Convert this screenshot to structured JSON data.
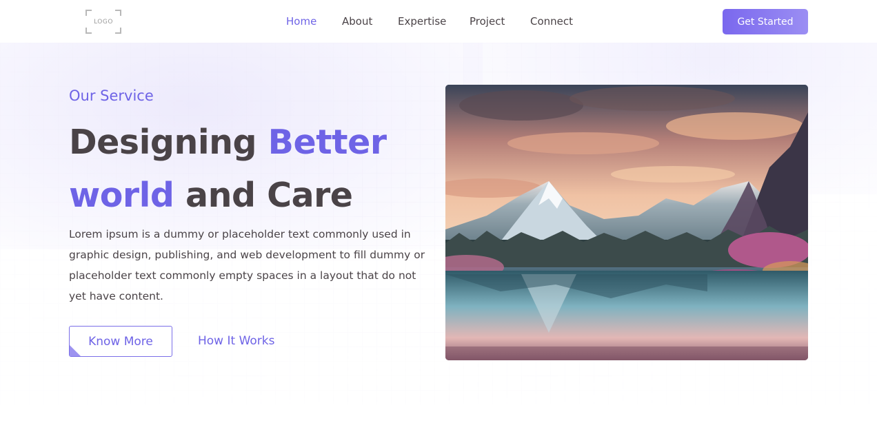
{
  "header": {
    "logo_text": "LOGO",
    "nav": [
      {
        "label": "Home",
        "active": true
      },
      {
        "label": "About",
        "active": false
      },
      {
        "label": "Expertise",
        "active": false
      },
      {
        "label": "Project",
        "active": false
      },
      {
        "label": "Connect",
        "active": false
      }
    ],
    "cta_label": "Get Started"
  },
  "hero": {
    "eyebrow": "Our Service",
    "headline": {
      "part1": "Designing ",
      "part2_highlight": "Better",
      "part3_highlight": "world",
      "part4": " and Care"
    },
    "body": "Lorem ipsum is a dummy or placeholder text commonly used in graphic design, publishing, and web development to fill dummy or placeholder text commonly empty spaces in a layout that do not yet have content.",
    "primary_button": "Know More",
    "secondary_link": "How It Works",
    "image_subject": "mountain-lake-landscape"
  },
  "colors": {
    "accent": "#6e63e6",
    "text": "#4a4347",
    "button_gradient_start": "#7a68ee",
    "button_gradient_end": "#9b8ef3"
  }
}
